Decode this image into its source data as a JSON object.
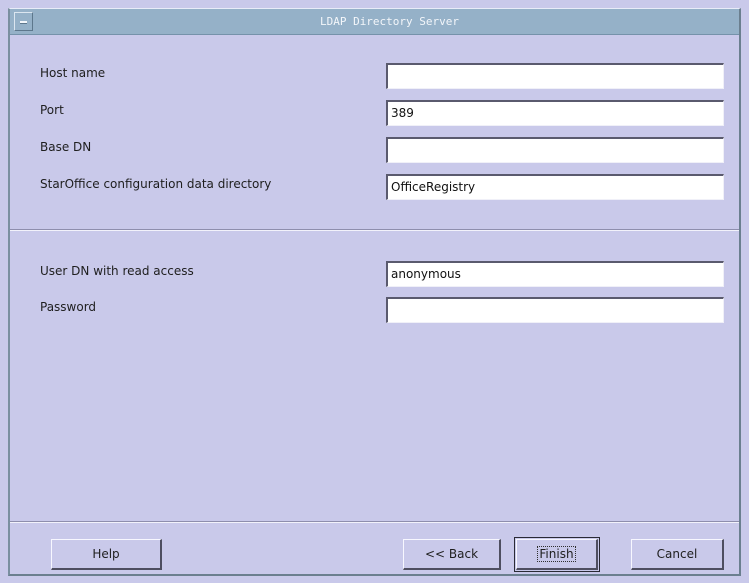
{
  "window": {
    "title": "LDAP Directory Server"
  },
  "fields": {
    "host_name": {
      "label": "Host name",
      "value": ""
    },
    "port": {
      "label": "Port",
      "value": "389"
    },
    "base_dn": {
      "label": "Base DN",
      "value": ""
    },
    "config_dir": {
      "label": "StarOffice configuration data directory",
      "value": "OfficeRegistry"
    },
    "user_dn": {
      "label": "User DN with read access",
      "value": "anonymous"
    },
    "password": {
      "label": "Password",
      "value": ""
    }
  },
  "buttons": {
    "help": "Help",
    "back": "<< Back",
    "finish": "Finish",
    "cancel": "Cancel"
  },
  "colors": {
    "background": "#c9c9ea",
    "titlebar": "#95b1c8"
  }
}
